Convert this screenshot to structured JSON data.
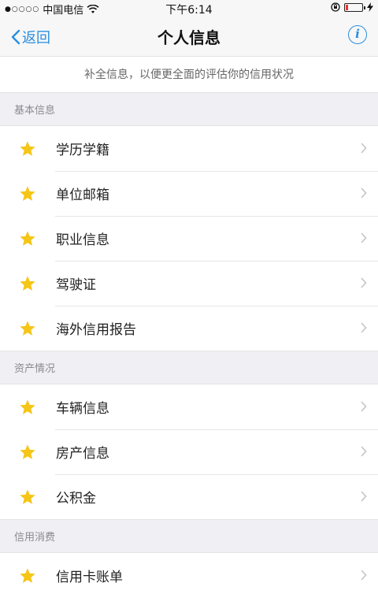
{
  "status_bar": {
    "signal": "●○○○○",
    "carrier": "中国电信",
    "time": "下午6:14"
  },
  "nav": {
    "back_label": "返回",
    "title": "个人信息",
    "info_glyph": "i"
  },
  "notice": "补全信息，以便更全面的评估你的信用状况",
  "sections": [
    {
      "title": "基本信息",
      "items": [
        "学历学籍",
        "单位邮箱",
        "职业信息",
        "驾驶证",
        "海外信用报告"
      ]
    },
    {
      "title": "资产情况",
      "items": [
        "车辆信息",
        "房产信息",
        "公积金"
      ]
    },
    {
      "title": "信用消费",
      "items": [
        "信用卡账单"
      ]
    }
  ],
  "colors": {
    "accent": "#2a8ee0",
    "star": "#f5c518",
    "background": "#efeff4"
  },
  "icons": {
    "row_icon": "star-icon",
    "row_arrow": "chevron-right-icon"
  }
}
